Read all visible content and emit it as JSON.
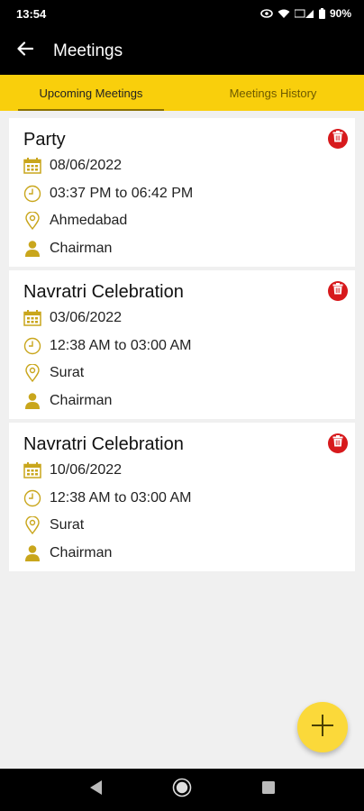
{
  "status": {
    "time": "13:54",
    "battery": "90%"
  },
  "appbar": {
    "title": "Meetings"
  },
  "tabs": [
    {
      "label": "Upcoming Meetings"
    },
    {
      "label": "Meetings History"
    }
  ],
  "meetings": [
    {
      "title": "Party",
      "date": "08/06/2022",
      "time": "03:37 PM to 06:42 PM",
      "location": "Ahmedabad",
      "role": "Chairman"
    },
    {
      "title": "Navratri Celebration",
      "date": "03/06/2022",
      "time": "12:38 AM to 03:00 AM",
      "location": "Surat",
      "role": "Chairman"
    },
    {
      "title": "Navratri Celebration",
      "date": "10/06/2022",
      "time": "12:38 AM to 03:00 AM",
      "location": "Surat",
      "role": "Chairman"
    }
  ],
  "colors": {
    "accent": "#f9cf0c",
    "delete": "#d7191c",
    "fab": "#fbd93a",
    "icon": "#c9a61c"
  },
  "icons": {
    "date": "calendar-icon",
    "time": "clock-icon",
    "location": "location-pin-icon",
    "role": "person-icon",
    "delete": "trash-icon",
    "fab": "plus-icon"
  }
}
